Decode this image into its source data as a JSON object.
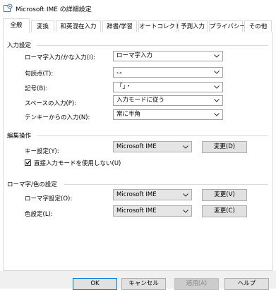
{
  "window": {
    "title": "Microsoft IME の詳細設定"
  },
  "tabs": [
    {
      "label": "全般",
      "active": true
    },
    {
      "label": "変換"
    },
    {
      "label": "和英混在入力"
    },
    {
      "label": "辞書/学習"
    },
    {
      "label": "オートコレクト"
    },
    {
      "label": "予測入力"
    },
    {
      "label": "プライバシー"
    },
    {
      "label": "その他"
    }
  ],
  "input_settings": {
    "title": "入力設定",
    "rows": [
      {
        "label": "ローマ字入力/かな入力(I):",
        "value": "ローマ字入力"
      },
      {
        "label": "句読点(T):",
        "value": "、。"
      },
      {
        "label": "記号(B):",
        "value": "「」・"
      },
      {
        "label": "スペースの入力(P):",
        "value": "入力モードに従う"
      },
      {
        "label": "テンキーからの入力(N):",
        "value": "常に半角"
      }
    ]
  },
  "edit_ops": {
    "title": "編集操作",
    "key_label": "キー設定(Y):",
    "key_value": "Microsoft IME",
    "key_button": "変更(D)",
    "checkbox_label": "直接入力モードを使用しない(U)",
    "checkbox_checked": true
  },
  "romaji_color": {
    "title": "ローマ字/色の設定",
    "romaji_label": "ローマ字設定(O):",
    "romaji_value": "Microsoft IME",
    "romaji_button": "変更(V)",
    "color_label": "色設定(L):",
    "color_value": "Microsoft IME",
    "color_button": "変更(C)"
  },
  "footer": {
    "ok": "OK",
    "cancel": "キャンセル",
    "apply": "適用(A)",
    "help": "ヘルプ"
  }
}
